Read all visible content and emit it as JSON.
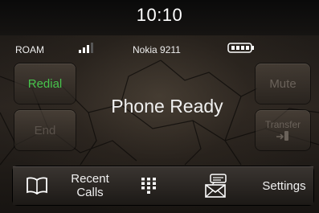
{
  "status_bar": {
    "time": "10:10",
    "roaming": "ROAM",
    "network": "Nokia 9211",
    "signal_icon": "signal-bars-icon",
    "battery_icon": "battery-icon"
  },
  "call_state": {
    "message": "Phone Ready"
  },
  "left_buttons": {
    "redial": "Redial",
    "end": "End"
  },
  "right_buttons": {
    "mute": "Mute",
    "transfer": "Transfer"
  },
  "bottom_tabs": {
    "phonebook_icon": "book-icon",
    "recent_calls_line1": "Recent",
    "recent_calls_line2": "Calls",
    "keypad_icon": "keypad-icon",
    "messaging_icon": "message-envelope-icon",
    "settings": "Settings"
  },
  "colors": {
    "redial_active": "#47c44c",
    "disabled": "#5a524b"
  }
}
